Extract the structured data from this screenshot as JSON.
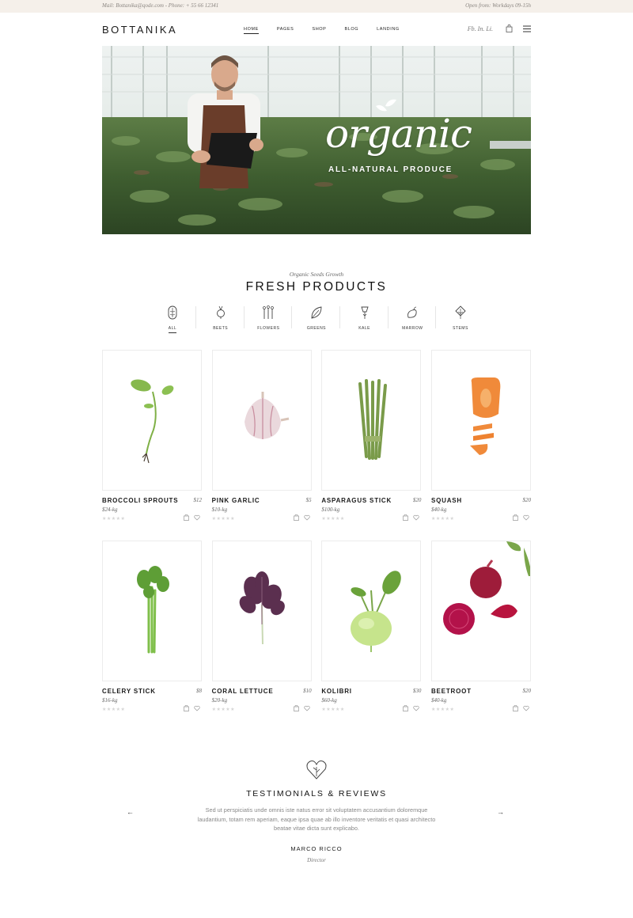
{
  "topbar": {
    "contact": "Mail: Bottanika@qode.com - Phone: + 55 66 12341",
    "hours": "Open from: Workdays 09-15h"
  },
  "header": {
    "logo": "BOTTANIKA",
    "nav": [
      "HOME",
      "PAGES",
      "SHOP",
      "BLOG",
      "LANDING"
    ],
    "social": "Fb. In. Li."
  },
  "hero": {
    "title": "organic",
    "subtitle": "ALL-NATURAL PRODUCE"
  },
  "products_section": {
    "eyebrow": "Organic Seeds Growth",
    "title": "FRESH PRODUCTS",
    "filters": [
      "ALL",
      "BEETS",
      "FLOWERS",
      "GREENS",
      "KALE",
      "MARROW",
      "STEMS"
    ],
    "active_filter": "ALL"
  },
  "products": [
    {
      "name": "BROCCOLI SPROUTS",
      "price": "$12",
      "unit": "$24-kg",
      "rating": 0
    },
    {
      "name": "PINK GARLIC",
      "price": "$5",
      "unit": "$10-kg",
      "rating": 0
    },
    {
      "name": "ASPARAGUS STICK",
      "price": "$20",
      "unit": "$100-kg",
      "rating": 0
    },
    {
      "name": "SQUASH",
      "price": "$20",
      "unit": "$40-kg",
      "rating": 0
    },
    {
      "name": "CELERY STICK",
      "price": "$8",
      "unit": "$16-kg",
      "rating": 0
    },
    {
      "name": "CORAL LETTUCE",
      "price": "$10",
      "unit": "$20-kg",
      "rating": 0
    },
    {
      "name": "KOLIBRI",
      "price": "$30",
      "unit": "$60-kg",
      "rating": 0
    },
    {
      "name": "BEETROOT",
      "price": "$20",
      "unit": "$40-kg",
      "rating": 0
    }
  ],
  "testimonials": {
    "title": "TESTIMONIALS & REVIEWS",
    "text": "Sed ut perspiciatis unde omnis iste natus error sit voluptatem accusantium doloremque laudantium, totam rem aperiam, eaque ipsa quae ab illo inventore veritatis et quasi architecto beatae vitae dicta sunt explicabo.",
    "author": "MARCO RICCO",
    "role": "Director",
    "prev_arrow": "←",
    "next_arrow": "→"
  },
  "colors": {
    "topbar_bg": "#f5f0ea",
    "text_dark": "#1a1a1a",
    "muted": "#888888"
  }
}
